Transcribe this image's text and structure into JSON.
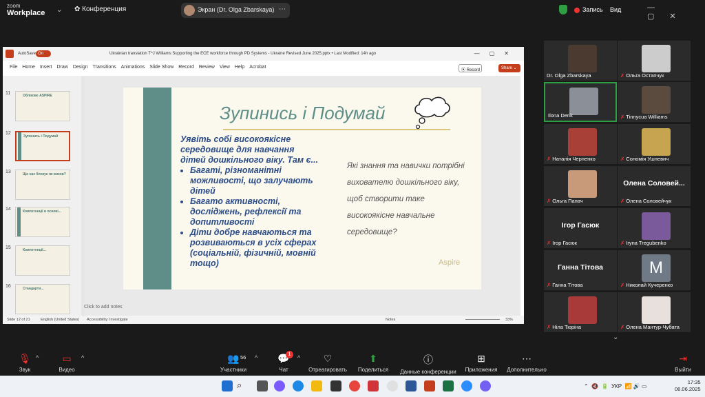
{
  "app": {
    "logo_line1": "zoom",
    "logo_line2": "Workplace",
    "meeting_label": "Конференция",
    "screen_label": "Экран (Dr. Olga Zbarskaya)",
    "record_label": "Запись",
    "view_label": "Вид"
  },
  "ppt": {
    "autosave": "AutoSave",
    "autosave_state": "On",
    "file_title": "Ukrainian translation T^J Williams Supporting the ECE workforce through PD Systems - Ukraine Revised June 2025.pptx • Last Modified: 14h ago",
    "menu": [
      "File",
      "Home",
      "Insert",
      "Draw",
      "Design",
      "Transitions",
      "Animations",
      "Slide Show",
      "Record",
      "Review",
      "View",
      "Help",
      "Acrobat"
    ],
    "record_btn": "Record",
    "share_btn": "Share",
    "thumbs": [
      {
        "num": "11",
        "title": "Облікове ASPIRE"
      },
      {
        "num": "12",
        "title": "Зупинись і Подумай"
      },
      {
        "num": "13",
        "title": "Що нас блокує як вихов?"
      },
      {
        "num": "14",
        "title": "Компетенції в основі..."
      },
      {
        "num": "15",
        "title": "Компетенції..."
      },
      {
        "num": "16",
        "title": "Стандарти..."
      }
    ],
    "notes_placeholder": "Click to add notes",
    "status_slide": "Slide 12 of 21",
    "status_lang": "English (United States)",
    "status_access": "Accessibility: Investigate",
    "status_notes": "Notes",
    "status_zoom": "33%"
  },
  "slide": {
    "title": "Зупинись і Подумай",
    "intro": "Уявіть собі високоякісне середовище для навчання дітей дошкільного віку. Там є...",
    "bullets": [
      "Багаті, різноманітні можливості, що залучають дітей",
      "Багато активності, досліджень, рефлексії та допитливості",
      "Діти добре навчаються та розвиваються в усіх сферах (соціальній, фізичній, мовній тощо)"
    ],
    "question": "Які знання та навички потрібні вихователю дошкільного віку, щоб створити таке високоякісне навчальне середовище?",
    "logo": "Aspire"
  },
  "participants": [
    {
      "name": "Dr. Olga Zbarskaya",
      "muted": false
    },
    {
      "name": "Ольга Остапчук",
      "muted": true
    },
    {
      "name": "Ilona Derik",
      "muted": false
    },
    {
      "name": "Tinnycua Williams",
      "muted": true
    },
    {
      "name": "Наталія Черненко",
      "muted": true
    },
    {
      "name": "Соломія Ушневич",
      "muted": true
    },
    {
      "name": "Ольга Папач",
      "muted": true
    },
    {
      "name": "Олена Соловейчук",
      "muted": true,
      "big": "Олена  Соловей..."
    },
    {
      "name": "Ігор Гасюк",
      "muted": true,
      "big": "Ігор Гасюк"
    },
    {
      "name": "Iryna Tregubenko",
      "muted": true
    },
    {
      "name": "Ганна Тітова",
      "muted": true,
      "big": "Ганна Тітова"
    },
    {
      "name": "Николай Кучеренко",
      "muted": true,
      "big": "M"
    },
    {
      "name": "Ніла Тюріна",
      "muted": true
    },
    {
      "name": "Олена Мантур-Чубата",
      "muted": true
    }
  ],
  "toolbar": {
    "audio": "Звук",
    "video": "Видео",
    "participants": "Участники",
    "participants_count": "56",
    "chat": "Чат",
    "chat_badge": "1",
    "react": "Отреагировать",
    "share": "Поделиться",
    "info": "Данные конференции",
    "apps": "Приложения",
    "more": "Дополнительно",
    "leave": "Выйти"
  },
  "taskbar": {
    "lang": "УКР",
    "time": "17:35",
    "date": "06.06.2025"
  }
}
